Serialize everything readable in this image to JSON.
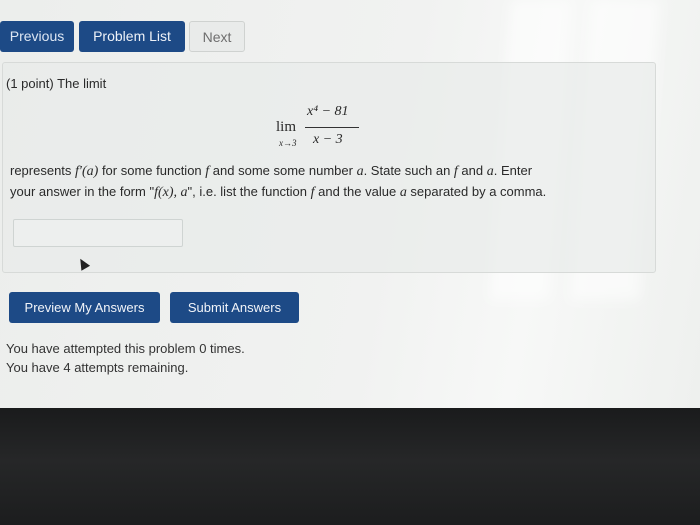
{
  "nav": {
    "previous": "Previous",
    "problem_list": "Problem List",
    "next": "Next"
  },
  "problem": {
    "points": "(1 point) The limit",
    "lim": "lim",
    "lim_sub": "x→3",
    "numerator": "x⁴ − 81",
    "denominator": "x − 3",
    "line1": {
      "a": "represents ",
      "b": "f′(a)",
      "c": " for some function ",
      "d": "f",
      "e": " and some some number ",
      "f": "a",
      "g": ". State such an ",
      "h": "f",
      "i": " and ",
      "j": "a",
      "k": ". Enter"
    },
    "line2": {
      "a": "your answer in the form \"",
      "b": "f(x), a",
      "c": "\", i.e. list the function ",
      "d": "f",
      "e": " and the value ",
      "f": "a",
      "g": " separated by a comma."
    },
    "answer_value": ""
  },
  "actions": {
    "preview": "Preview My Answers",
    "submit": "Submit Answers"
  },
  "status": {
    "attempted": "You have attempted this problem 0 times.",
    "remaining": "You have 4 attempts remaining."
  }
}
